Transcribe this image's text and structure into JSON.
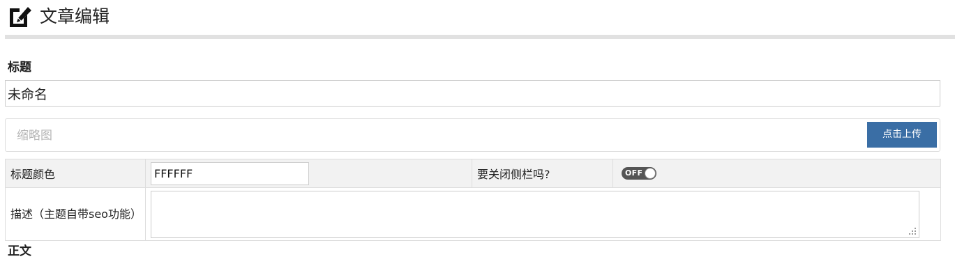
{
  "header": {
    "icon": "edit-document-icon",
    "title": "文章编辑"
  },
  "title_field": {
    "label": "标题",
    "value": "未命名"
  },
  "thumbnail": {
    "placeholder": "缩略图",
    "upload_label": "点击上传",
    "upload_color": "#3a6ea5"
  },
  "settings": {
    "title_color_label": "标题颜色",
    "title_color_value": "FFFFFF",
    "close_sidebar_label": "要关闭侧栏吗?",
    "close_sidebar_toggle": "OFF",
    "description_label": "描述（主题自带seo功能）",
    "description_value": ""
  },
  "body_label": "正文"
}
